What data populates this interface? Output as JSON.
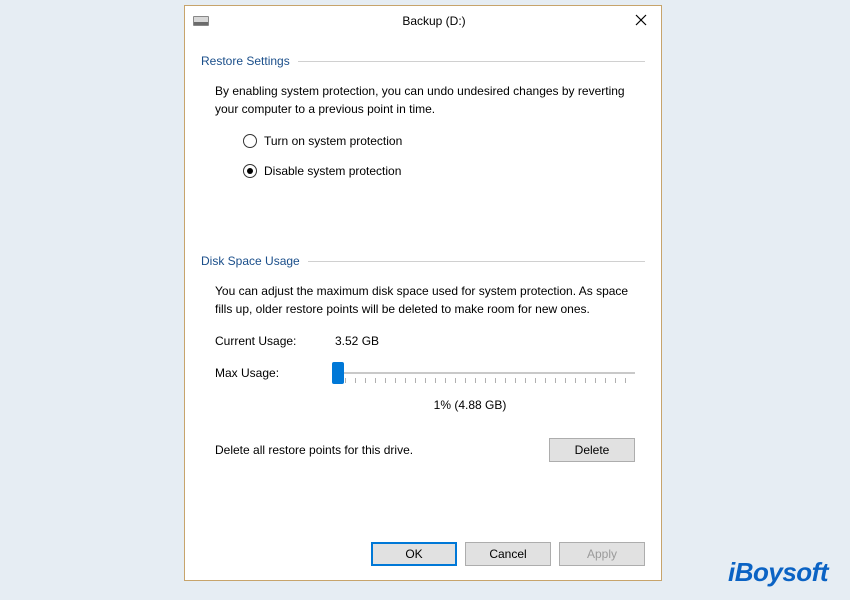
{
  "window": {
    "title": "Backup (D:)"
  },
  "restore": {
    "header": "Restore Settings",
    "description": "By enabling system protection, you can undo undesired changes by reverting your computer to a previous point in time.",
    "option_on": "Turn on system protection",
    "option_off": "Disable system protection",
    "selected": "off"
  },
  "disk": {
    "header": "Disk Space Usage",
    "description": "You can adjust the maximum disk space used for system protection. As space fills up, older restore points will be deleted to make room for new ones.",
    "current_label": "Current Usage:",
    "current_value": "3.52 GB",
    "max_label": "Max Usage:",
    "slider_value_label": "1% (4.88 GB)",
    "delete_text": "Delete all restore points for this drive.",
    "delete_btn": "Delete"
  },
  "buttons": {
    "ok": "OK",
    "cancel": "Cancel",
    "apply": "Apply"
  },
  "watermark": "iBoysoft"
}
